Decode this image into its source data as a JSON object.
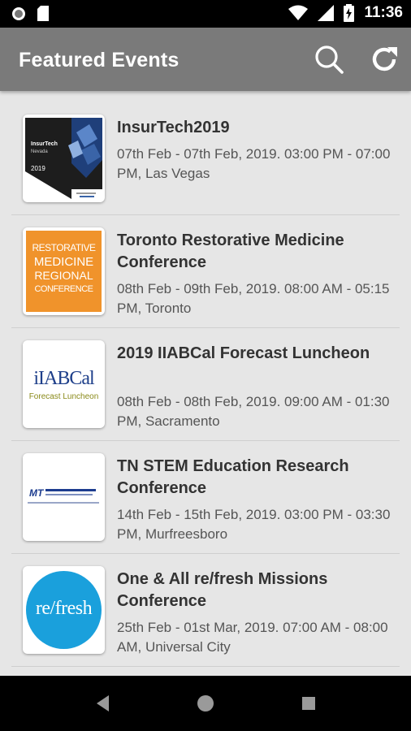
{
  "status": {
    "time": "11:36"
  },
  "header": {
    "title": "Featured Events"
  },
  "events": [
    {
      "title": "InsurTech2019",
      "meta": "07th Feb - 07th Feb, 2019. 03:00 PM - 07:00 PM, Las Vegas",
      "thumb": {
        "line1": "InsurTech",
        "line2": "Nevada",
        "year": "2019"
      }
    },
    {
      "title": "Toronto Restorative Medicine Conference",
      "meta": "08th Feb - 09th Feb, 2019. 08:00 AM - 05:15 PM, Toronto",
      "thumb": {
        "line1": "RESTORATIVE",
        "line2": "MEDICINE",
        "line3": "REGIONAL",
        "line4": "CONFERENCE"
      }
    },
    {
      "title": "2019 IIABCal Forecast Luncheon",
      "meta": "08th Feb - 08th Feb, 2019. 09:00 AM - 01:30 PM, Sacramento",
      "thumb": {
        "line1": "iIABCal",
        "line2": "Forecast Luncheon"
      }
    },
    {
      "title": "TN STEM Education Research Conference",
      "meta": "14th Feb - 15th Feb, 2019. 03:00 PM - 03:30 PM, Murfreesboro",
      "thumb": {
        "line1": "MT"
      }
    },
    {
      "title": "One & All re/fresh Missions Conference",
      "meta": "25th Feb - 01st Mar, 2019. 07:00 AM - 08:00 AM, Universal City",
      "thumb": {
        "line1": "re/fresh"
      }
    }
  ]
}
